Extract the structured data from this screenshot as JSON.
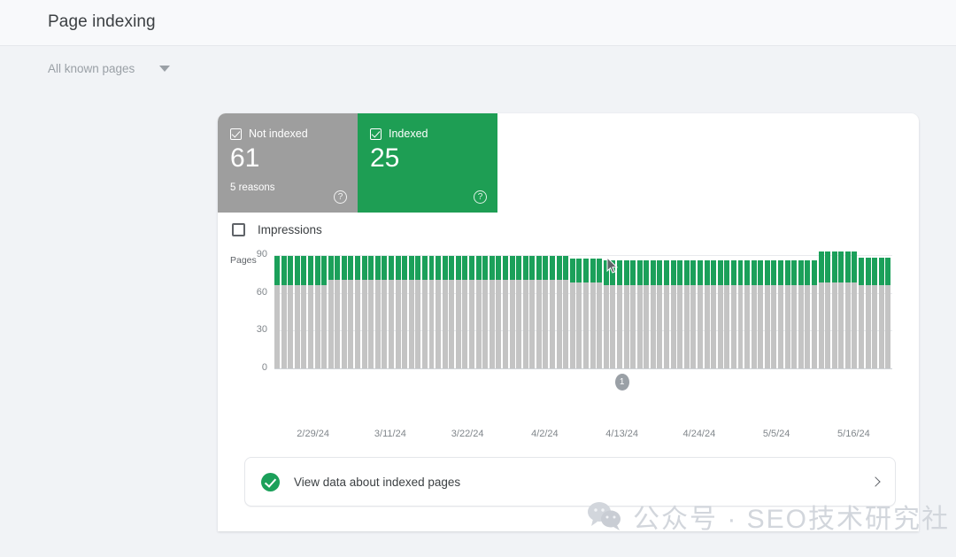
{
  "header": {
    "title": "Page indexing",
    "filter_label": "All known pages",
    "caret_icon": "chevron-down-icon"
  },
  "tiles": [
    {
      "label": "Not indexed",
      "value": "61",
      "sub": "5 reasons",
      "color": "#9e9e9e",
      "checkbox": "checked",
      "help_icon": "?"
    },
    {
      "label": "Indexed",
      "value": "25",
      "sub": "",
      "color": "#1e9e54",
      "checkbox": "checked",
      "help_icon": "?"
    }
  ],
  "impressions": {
    "label": "Impressions",
    "checked": false
  },
  "cta": {
    "icon": "check-circle-icon",
    "text": "View data about indexed pages",
    "chevron": "chevron-right-icon"
  },
  "watermark": {
    "icon": "wechat-icon",
    "text": "公众号 · SEO技术研究社"
  },
  "colors": {
    "indexed": "#1ba05a",
    "not_indexed": "#c4c4c4",
    "background": "#f1f3f6",
    "card": "#ffffff"
  },
  "chart_data": {
    "type": "bar",
    "stacked": true,
    "title": "",
    "ylabel": "Pages",
    "xlabel": "",
    "ylim": [
      0,
      90
    ],
    "yticks": [
      0,
      30,
      60,
      90
    ],
    "grid": true,
    "legend_position": "top-tiles",
    "annotations": [
      {
        "label": "1",
        "at_tick": "4/13/24"
      }
    ],
    "tick_labels": [
      "2/29/24",
      "3/11/24",
      "3/22/24",
      "4/2/24",
      "4/13/24",
      "4/24/24",
      "5/5/24",
      "5/16/24"
    ],
    "series": [
      {
        "name": "Not indexed",
        "color": "#c4c4c4",
        "values": [
          66,
          66,
          66,
          66,
          66,
          66,
          66,
          66,
          70,
          70,
          70,
          70,
          70,
          70,
          70,
          70,
          70,
          70,
          70,
          70,
          70,
          70,
          70,
          70,
          70,
          70,
          70,
          70,
          70,
          70,
          70,
          70,
          70,
          70,
          70,
          70,
          70,
          70,
          70,
          70,
          70,
          70,
          70,
          70,
          68,
          68,
          68,
          68,
          68,
          66,
          66,
          66,
          66,
          66,
          66,
          66,
          66,
          66,
          66,
          66,
          66,
          66,
          66,
          66,
          66,
          66,
          66,
          66,
          66,
          66,
          66,
          66,
          66,
          66,
          66,
          66,
          66,
          66,
          66,
          66,
          66,
          68,
          68,
          68,
          68,
          68,
          68,
          66,
          66,
          66,
          66,
          66
        ]
      },
      {
        "name": "Indexed",
        "color": "#1ba05a",
        "values": [
          23,
          23,
          23,
          23,
          23,
          23,
          23,
          23,
          19,
          19,
          19,
          19,
          19,
          19,
          19,
          19,
          19,
          19,
          19,
          19,
          19,
          19,
          19,
          19,
          19,
          19,
          19,
          19,
          19,
          19,
          19,
          19,
          19,
          19,
          19,
          19,
          19,
          19,
          19,
          19,
          19,
          19,
          19,
          19,
          19,
          19,
          19,
          19,
          19,
          20,
          20,
          20,
          20,
          20,
          20,
          20,
          20,
          20,
          20,
          20,
          20,
          20,
          20,
          20,
          20,
          20,
          20,
          20,
          20,
          20,
          20,
          20,
          20,
          20,
          20,
          20,
          20,
          20,
          20,
          20,
          20,
          25,
          25,
          25,
          25,
          25,
          25,
          22,
          22,
          22,
          22,
          22
        ]
      }
    ]
  }
}
